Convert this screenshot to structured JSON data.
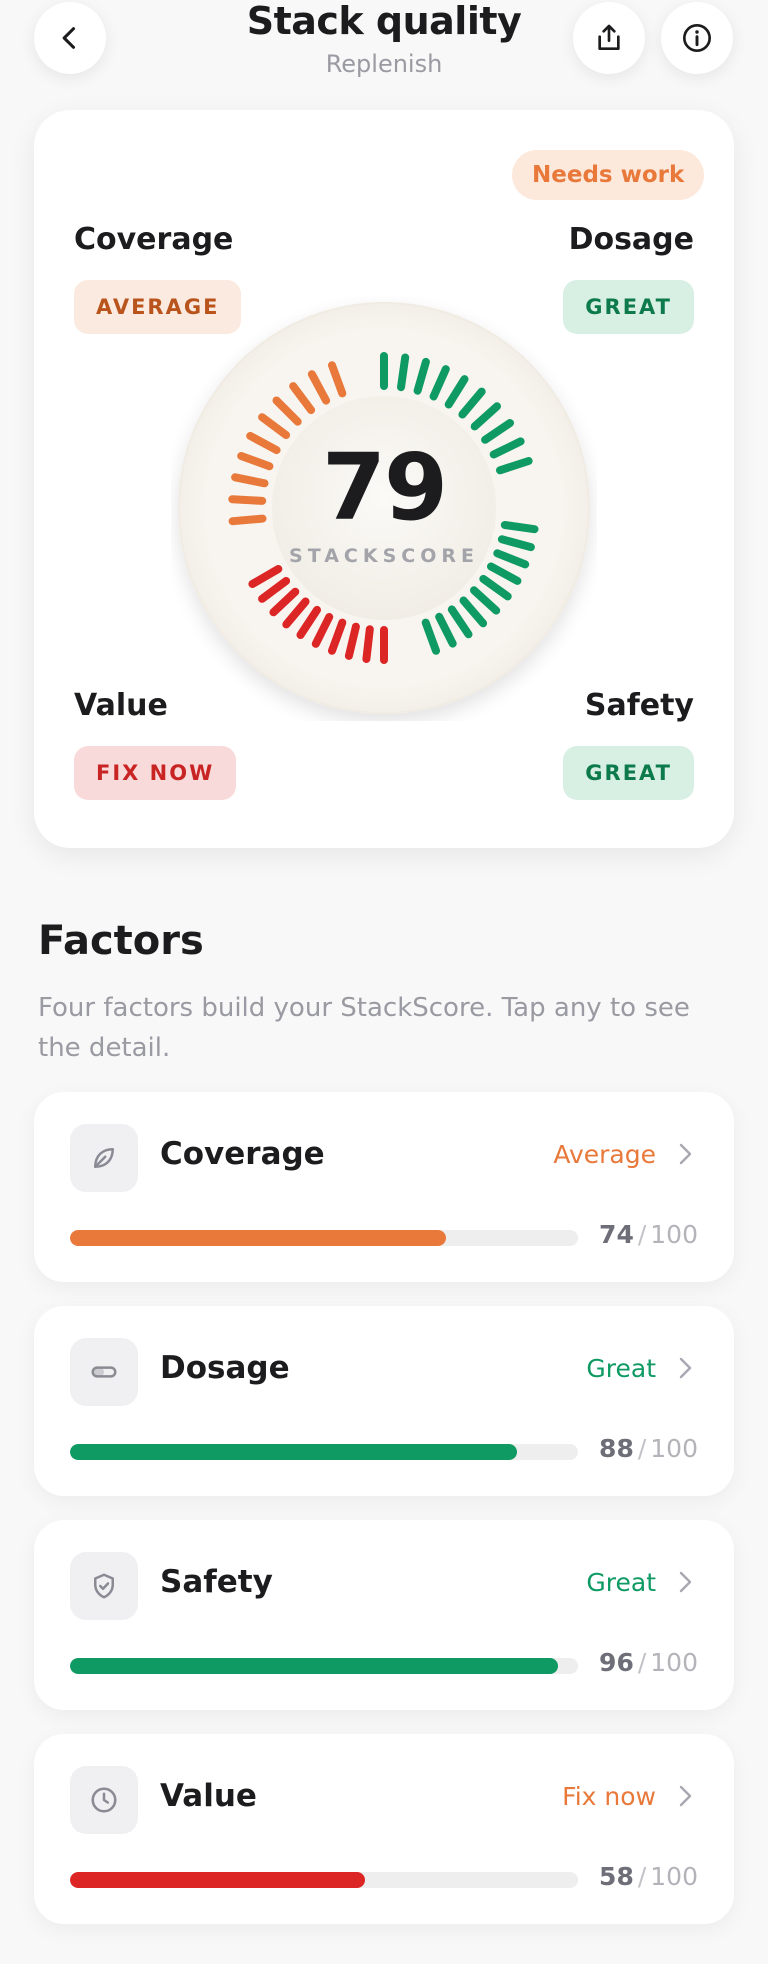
{
  "header": {
    "title": "Stack quality",
    "subtitle": "Replenish",
    "back_icon": "chevron-left-icon",
    "share_icon": "share-icon",
    "info_icon": "info-icon"
  },
  "score_card": {
    "overall_badge": "Needs work",
    "score": "79",
    "score_label": "STACKSCORE",
    "quadrants": {
      "coverage": {
        "label": "Coverage",
        "rating": "AVERAGE"
      },
      "dosage": {
        "label": "Dosage",
        "rating": "GREAT"
      },
      "value": {
        "label": "Value",
        "rating": "FIX NOW"
      },
      "safety": {
        "label": "Safety",
        "rating": "GREAT"
      }
    },
    "colors": {
      "orange": "#e8793a",
      "green": "#0f9a63",
      "red": "#dc2626"
    }
  },
  "factors": {
    "title": "Factors",
    "description": "Four factors build your StackScore. Tap any to see the detail.",
    "items": [
      {
        "name": "Coverage",
        "icon": "leaf-icon",
        "status": "Average",
        "score": "74",
        "max": "100",
        "color": "#e8793a",
        "fill": 0.74
      },
      {
        "name": "Dosage",
        "icon": "pill-icon",
        "status": "Great",
        "score": "88",
        "max": "100",
        "color": "#0f9a63",
        "fill": 0.88
      },
      {
        "name": "Safety",
        "icon": "shield-check-icon",
        "status": "Great",
        "score": "96",
        "max": "100",
        "color": "#0f9a63",
        "fill": 0.96
      },
      {
        "name": "Value",
        "icon": "clock-icon",
        "status": "Fix now",
        "score": "58",
        "max": "100",
        "color": "#dc2626",
        "status_color": "#e8793a",
        "fill": 0.58
      }
    ]
  }
}
